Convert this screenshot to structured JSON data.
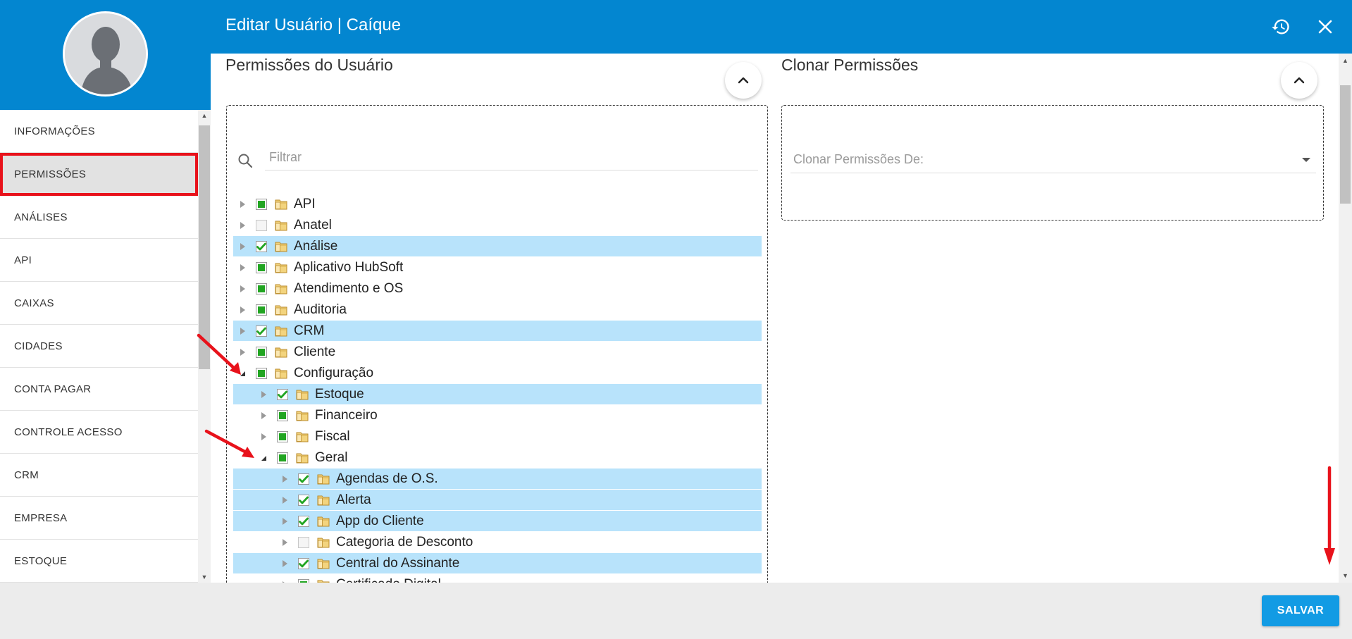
{
  "header": {
    "title": "Editar Usuário | Caíque",
    "history_icon": "history-icon",
    "close_icon": "close-icon"
  },
  "sidebar": {
    "items": [
      {
        "label": "INFORMAÇÕES",
        "active": false
      },
      {
        "label": "PERMISSÕES",
        "active": true
      },
      {
        "label": "ANÁLISES",
        "active": false
      },
      {
        "label": "API",
        "active": false
      },
      {
        "label": "CAIXAS",
        "active": false
      },
      {
        "label": "CIDADES",
        "active": false
      },
      {
        "label": "CONTA PAGAR",
        "active": false
      },
      {
        "label": "CONTROLE ACESSO",
        "active": false
      },
      {
        "label": "CRM",
        "active": false
      },
      {
        "label": "EMPRESA",
        "active": false
      },
      {
        "label": "ESTOQUE",
        "active": false
      }
    ]
  },
  "permissions": {
    "title": "Permissões do Usuário",
    "filter_placeholder": "Filtrar",
    "tree": [
      {
        "label": "API",
        "level": 0,
        "expanded": false,
        "check": "partial",
        "selected": false
      },
      {
        "label": "Anatel",
        "level": 0,
        "expanded": false,
        "check": "none",
        "selected": false
      },
      {
        "label": "Análise",
        "level": 0,
        "expanded": false,
        "check": "checked",
        "selected": true
      },
      {
        "label": "Aplicativo HubSoft",
        "level": 0,
        "expanded": false,
        "check": "partial",
        "selected": false
      },
      {
        "label": "Atendimento e OS",
        "level": 0,
        "expanded": false,
        "check": "partial",
        "selected": false
      },
      {
        "label": "Auditoria",
        "level": 0,
        "expanded": false,
        "check": "partial",
        "selected": false
      },
      {
        "label": "CRM",
        "level": 0,
        "expanded": false,
        "check": "checked",
        "selected": true
      },
      {
        "label": "Cliente",
        "level": 0,
        "expanded": false,
        "check": "partial",
        "selected": false
      },
      {
        "label": "Configuração",
        "level": 0,
        "expanded": true,
        "check": "partial",
        "selected": false
      },
      {
        "label": "Estoque",
        "level": 1,
        "expanded": false,
        "check": "checked",
        "selected": true
      },
      {
        "label": "Financeiro",
        "level": 1,
        "expanded": false,
        "check": "partial",
        "selected": false
      },
      {
        "label": "Fiscal",
        "level": 1,
        "expanded": false,
        "check": "partial",
        "selected": false
      },
      {
        "label": "Geral",
        "level": 1,
        "expanded": true,
        "check": "partial",
        "selected": false
      },
      {
        "label": "Agendas de O.S.",
        "level": 2,
        "expanded": false,
        "check": "checked",
        "selected": true
      },
      {
        "label": "Alerta",
        "level": 2,
        "expanded": false,
        "check": "checked",
        "selected": true
      },
      {
        "label": "App do Cliente",
        "level": 2,
        "expanded": false,
        "check": "checked",
        "selected": true
      },
      {
        "label": "Categoria de Desconto",
        "level": 2,
        "expanded": false,
        "check": "none",
        "selected": false
      },
      {
        "label": "Central do Assinante",
        "level": 2,
        "expanded": false,
        "check": "checked",
        "selected": true
      },
      {
        "label": "Certificado Digital",
        "level": 2,
        "expanded": false,
        "check": "partial",
        "selected": false
      }
    ]
  },
  "clone": {
    "title": "Clonar Permissões",
    "select_label": "Clonar Permissões De:"
  },
  "footer": {
    "save_label": "SALVAR"
  },
  "colors": {
    "primary": "#0386d0",
    "save_button": "#129be4",
    "selected_row": "#b8e3fb",
    "check_green": "#22a522",
    "annotation_red": "#e8121b"
  }
}
